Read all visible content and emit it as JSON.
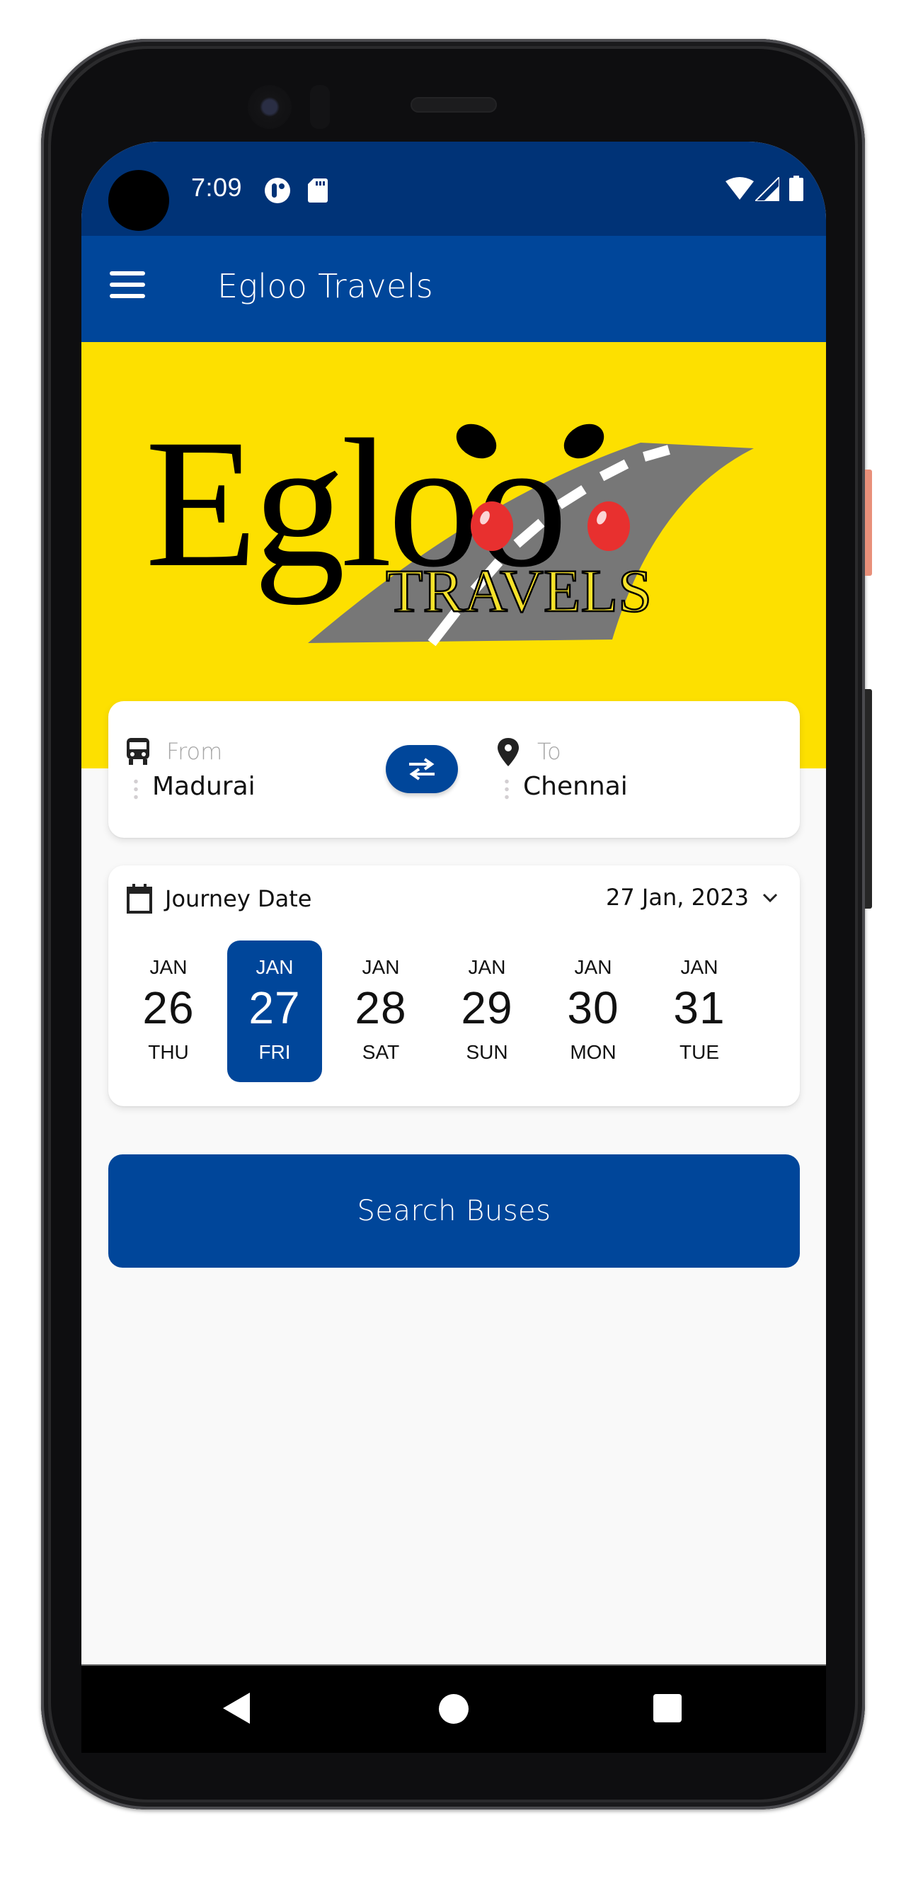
{
  "status_bar": {
    "time": "7:09",
    "left_icons": [
      "data-saver-icon",
      "sd-card-icon"
    ],
    "right_icons": [
      "wifi-icon",
      "cellular-signal-icon",
      "battery-icon"
    ]
  },
  "app_bar": {
    "title": "Egloo Travels",
    "menu_icon": "hamburger-menu-icon"
  },
  "banner": {
    "logo_text": "Egloo",
    "logo_subtext": "TRAVELS"
  },
  "route": {
    "from": {
      "label": "From",
      "value": "Madurai",
      "icon": "bus-icon"
    },
    "to": {
      "label": "To",
      "value": "Chennai",
      "icon": "location-pin-icon"
    },
    "swap_icon": "swap-arrows-icon"
  },
  "journey": {
    "label": "Journey Date",
    "selected_date": "27 Jan, 2023",
    "dates": [
      {
        "month": "JAN",
        "day": "26",
        "weekday": "THU",
        "selected": false
      },
      {
        "month": "JAN",
        "day": "27",
        "weekday": "FRI",
        "selected": true
      },
      {
        "month": "JAN",
        "day": "28",
        "weekday": "SAT",
        "selected": false
      },
      {
        "month": "JAN",
        "day": "29",
        "weekday": "SUN",
        "selected": false
      },
      {
        "month": "JAN",
        "day": "30",
        "weekday": "MON",
        "selected": false
      },
      {
        "month": "JAN",
        "day": "31",
        "weekday": "TUE",
        "selected": false
      }
    ]
  },
  "search_button": {
    "label": "Search Buses"
  },
  "colors": {
    "primary": "#00469a",
    "status_bar": "#003377",
    "banner": "#fde000",
    "background": "#f9f9f9"
  }
}
